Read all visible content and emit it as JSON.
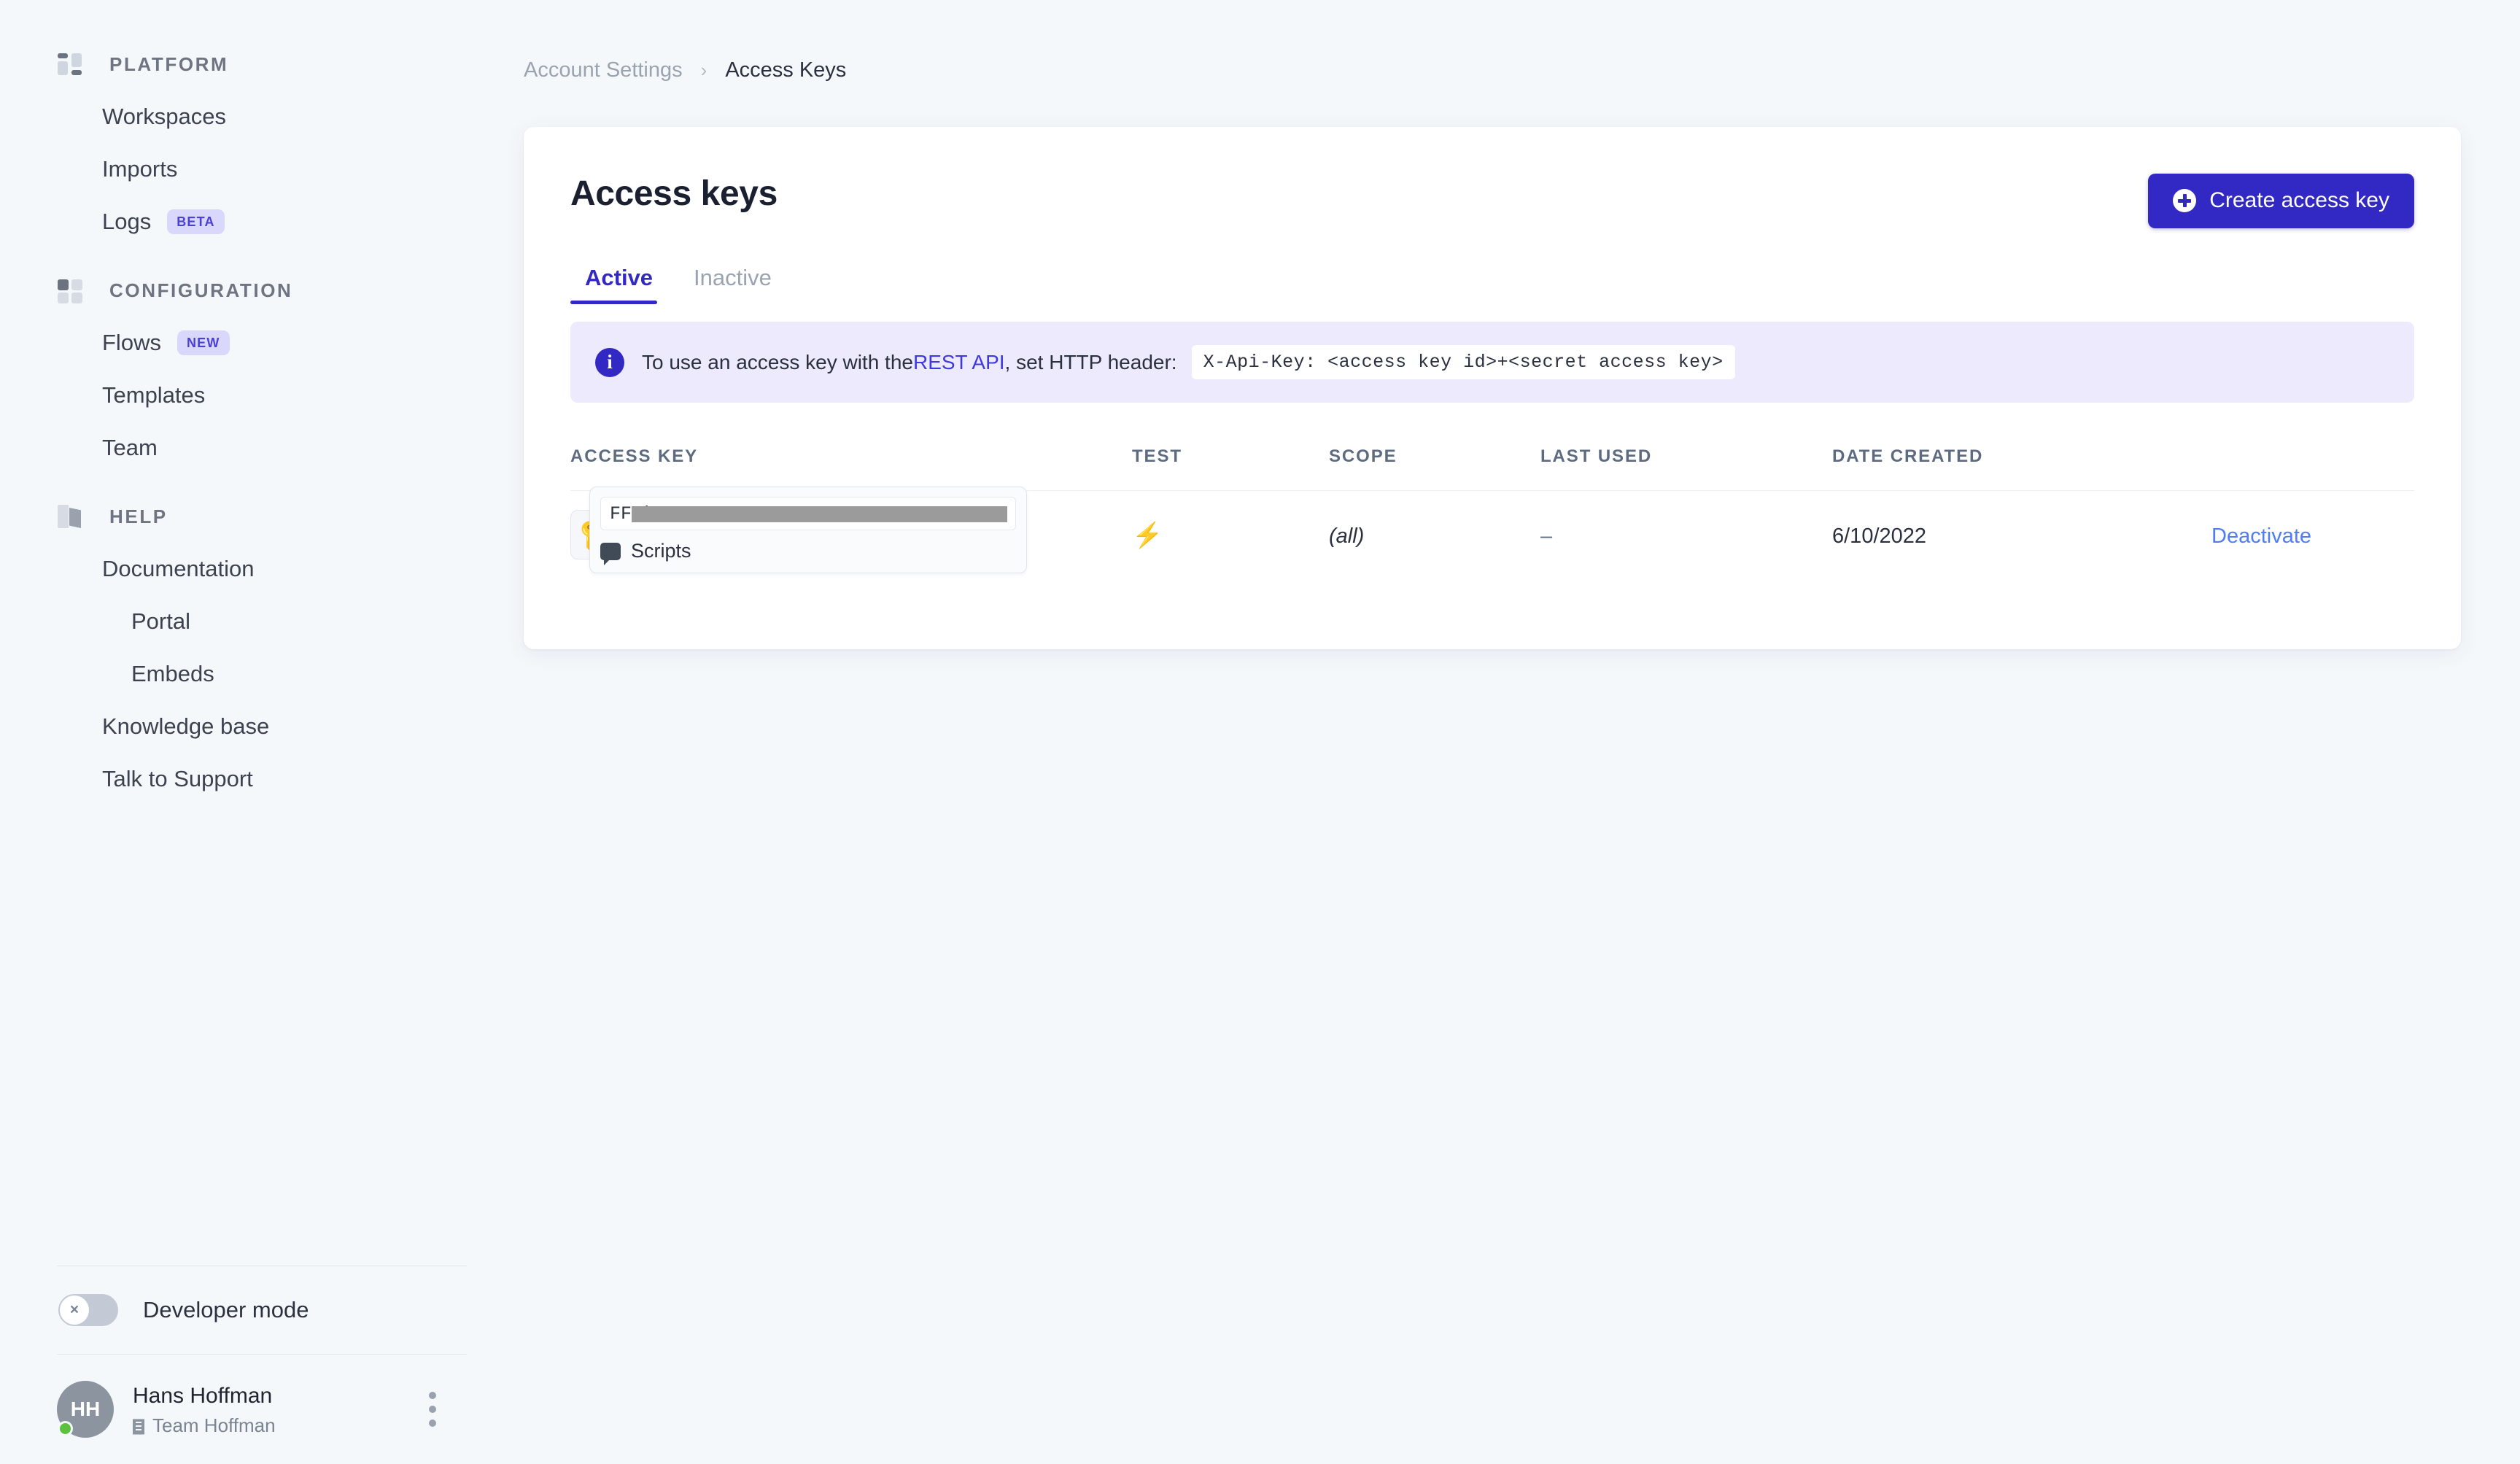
{
  "sidebar": {
    "sections": [
      {
        "label": "PLATFORM",
        "icon": "platform-grid-icon",
        "items": [
          {
            "label": "Workspaces",
            "badge": null,
            "sub": false
          },
          {
            "label": "Imports",
            "badge": null,
            "sub": false
          },
          {
            "label": "Logs",
            "badge": "BETA",
            "sub": false
          }
        ]
      },
      {
        "label": "CONFIGURATION",
        "icon": "configuration-grid-icon",
        "items": [
          {
            "label": "Flows",
            "badge": "NEW",
            "sub": false
          },
          {
            "label": "Templates",
            "badge": null,
            "sub": false
          },
          {
            "label": "Team",
            "badge": null,
            "sub": false
          }
        ]
      },
      {
        "label": "HELP",
        "icon": "book-icon",
        "items": [
          {
            "label": "Documentation",
            "badge": null,
            "sub": false
          },
          {
            "label": "Portal",
            "badge": null,
            "sub": true
          },
          {
            "label": "Embeds",
            "badge": null,
            "sub": true
          },
          {
            "label": "Knowledge base",
            "badge": null,
            "sub": false
          },
          {
            "label": "Talk to Support",
            "badge": null,
            "sub": false
          }
        ]
      }
    ],
    "developer_mode": {
      "label": "Developer mode",
      "state": "off",
      "knob_glyph": "×"
    },
    "user": {
      "initials": "HH",
      "name": "Hans Hoffman",
      "team": "Team Hoffman",
      "status": "online"
    }
  },
  "breadcrumb": {
    "parent": "Account Settings",
    "separator": "›",
    "current": "Access Keys"
  },
  "page": {
    "title": "Access keys",
    "create_button": "Create access key"
  },
  "tabs": [
    {
      "label": "Active",
      "active": true
    },
    {
      "label": "Inactive",
      "active": false
    }
  ],
  "banner": {
    "text_before_link": "To use an access key with the ",
    "link": "REST API",
    "text_after_link": ", set HTTP header:",
    "code": "X-Api-Key: <access key id>+<secret access key>"
  },
  "table": {
    "columns": [
      "ACCESS KEY",
      "TEST",
      "SCOPE",
      "LAST USED",
      "DATE CREATED",
      ""
    ],
    "rows": [
      {
        "key_prefix": "FF0",
        "key_suffix": ")",
        "key_note": "Scripts",
        "test": "lightning-bolt-icon",
        "scope": "(all)",
        "last_used": "–",
        "date_created": "6/10/2022",
        "action": "Deactivate"
      }
    ]
  },
  "colors": {
    "accent": "#3228c4",
    "link": "#4f7df3",
    "banner_bg": "#eceafc",
    "page_bg": "#f5f8fb",
    "status_online": "#5cc13c"
  }
}
